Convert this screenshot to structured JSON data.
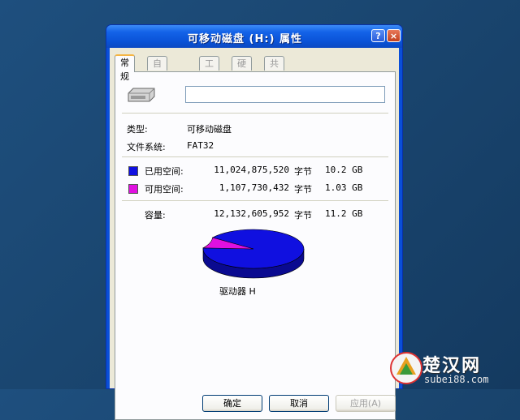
{
  "window": {
    "title": "可移动磁盘 (H:) 属性",
    "help_label": "?",
    "close_label": "×"
  },
  "tabs": [
    {
      "label": "常规",
      "active": true
    },
    {
      "label": "自动播放",
      "active": false
    },
    {
      "label": "工具",
      "active": false
    },
    {
      "label": "硬件",
      "active": false
    },
    {
      "label": "共享",
      "active": false
    }
  ],
  "general": {
    "name_value": "",
    "type_label": "类型:",
    "type_value": "可移动磁盘",
    "fs_label": "文件系统:",
    "fs_value": "FAT32",
    "used_label": "已用空间:",
    "used_bytes": "11,024,875,520",
    "used_unit": "字节",
    "used_size": "10.2 GB",
    "free_label": "可用空间:",
    "free_bytes": "1,107,730,432",
    "free_unit": "字节",
    "free_size": "1.03 GB",
    "capacity_label": "容量:",
    "capacity_bytes": "12,132,605,952",
    "capacity_unit": "字节",
    "capacity_size": "11.2 GB",
    "drive_label": "驱动器 H",
    "used_fraction": 0.909,
    "used_color": "#1010e0",
    "free_color": "#e010e0"
  },
  "buttons": {
    "ok": "确定",
    "cancel": "取消",
    "apply": "应用(A)"
  },
  "watermark": {
    "brand": "楚汉网",
    "url": "subei88.com"
  }
}
